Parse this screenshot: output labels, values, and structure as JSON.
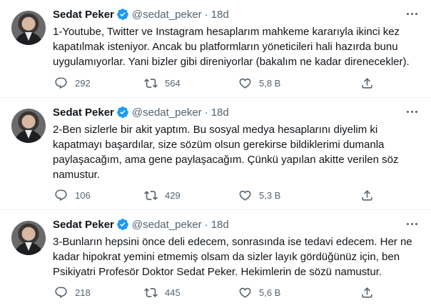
{
  "author": {
    "name": "Sedat Peker",
    "handle": "@sedat_peker",
    "separator": "·",
    "verified": true
  },
  "colors": {
    "text": "#0f1419",
    "secondary": "#536471",
    "verified_badge": "#1d9bf0",
    "divider": "#eff3f4"
  },
  "tweets": [
    {
      "time": "18d",
      "text": "1-Youtube, Twitter ve Instagram hesaplarım mahkeme kararıyla ikinci kez\nkapatılmak isteniyor. Ancak bu platformların yöneticileri hali hazırda bunu\nuygulamıyorlar. Yani bizler gibi direniyorlar (bakalım ne kadar direnecekler).",
      "replies": "292",
      "retweets": "564",
      "likes": "5,8 B"
    },
    {
      "time": "18d",
      "text": "2-Ben sizlerle bir akit yaptım. Bu sosyal medya hesaplarını diyelim ki\nkapatmayı başardılar, size sözüm olsun gerekirse bildiklerimi dumanla\npaylaşacağım, ama gene paylaşacağım. Çünkü yapılan akitte verilen söz\nnamustur.",
      "replies": "106",
      "retweets": "429",
      "likes": "5,3 B"
    },
    {
      "time": "18d",
      "text": "3-Bunların hepsini önce deli edecem, sonrasında ise tedavi edecem. Her ne\nkadar hipokrat yemini etmemiş olsam da sizler layık gördüğünüz için, ben\nPsikiyatri Profesör Doktor Sedat Peker. Hekimlerin de sözü namustur.",
      "replies": "218",
      "retweets": "445",
      "likes": "5,6 B"
    }
  ]
}
